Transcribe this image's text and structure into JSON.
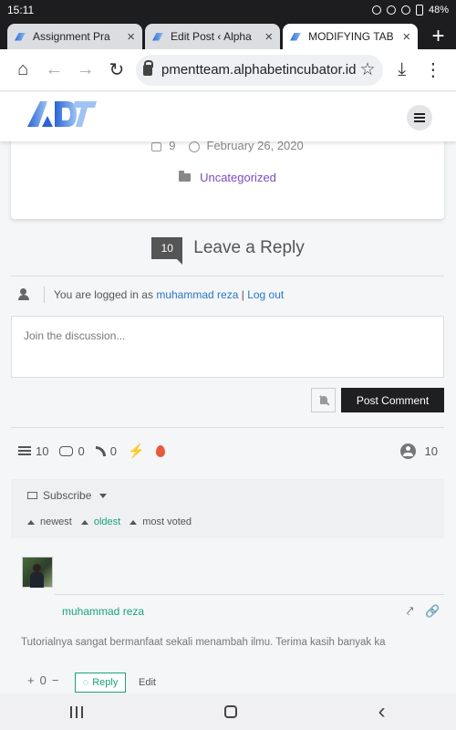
{
  "status_bar": {
    "time": "15:11",
    "battery": "48%"
  },
  "tabs": [
    {
      "label": "Assignment Pra",
      "close": "×",
      "active": false
    },
    {
      "label": "Edit Post ‹ Alpha",
      "close": "×",
      "active": false
    },
    {
      "label": "MODIFYING TAB",
      "close": "×",
      "active": true
    }
  ],
  "new_tab": "+",
  "toolbar": {
    "url": "pmentteam.alphabetincubator.id",
    "home": "⌂",
    "back": "←",
    "forward": "→",
    "reload": "↻",
    "star": "☆",
    "download": "⤓",
    "menu": "⋮"
  },
  "post": {
    "comments_count": "9",
    "date": "February 26, 2020",
    "category": "Uncategorized"
  },
  "reply": {
    "count": "10",
    "title": "Leave a Reply",
    "logged_prefix": "You are logged in as",
    "user_name": "muhammad reza",
    "separator": "|",
    "logout": "Log out",
    "placeholder": "Join the discussion...",
    "post_button": "Post Comment"
  },
  "stats": {
    "threads": "10",
    "replies": "0",
    "followers": "0",
    "commenters": "10",
    "bolt": "⚡"
  },
  "panel": {
    "subscribe": "Subscribe",
    "sort_newest": "newest",
    "sort_oldest": "oldest",
    "sort_most_voted": "most voted"
  },
  "comment": {
    "author": "muhammad reza",
    "text": "Tutorialnya sangat bermanfaat sekali menambah ilmu. Terima kasih banyak ka",
    "share": "⤤",
    "link": "🔗",
    "vote_plus": "+",
    "vote_count": "0",
    "vote_minus": "−",
    "reply_label": "Reply",
    "edit_label": "Edit"
  },
  "nav": {
    "back": "‹"
  },
  "colors": {
    "accent_green": "#1aa37c",
    "link_blue": "#2b76c6",
    "category_purple": "#7a4bc3",
    "dark_button": "#1f1f21"
  }
}
